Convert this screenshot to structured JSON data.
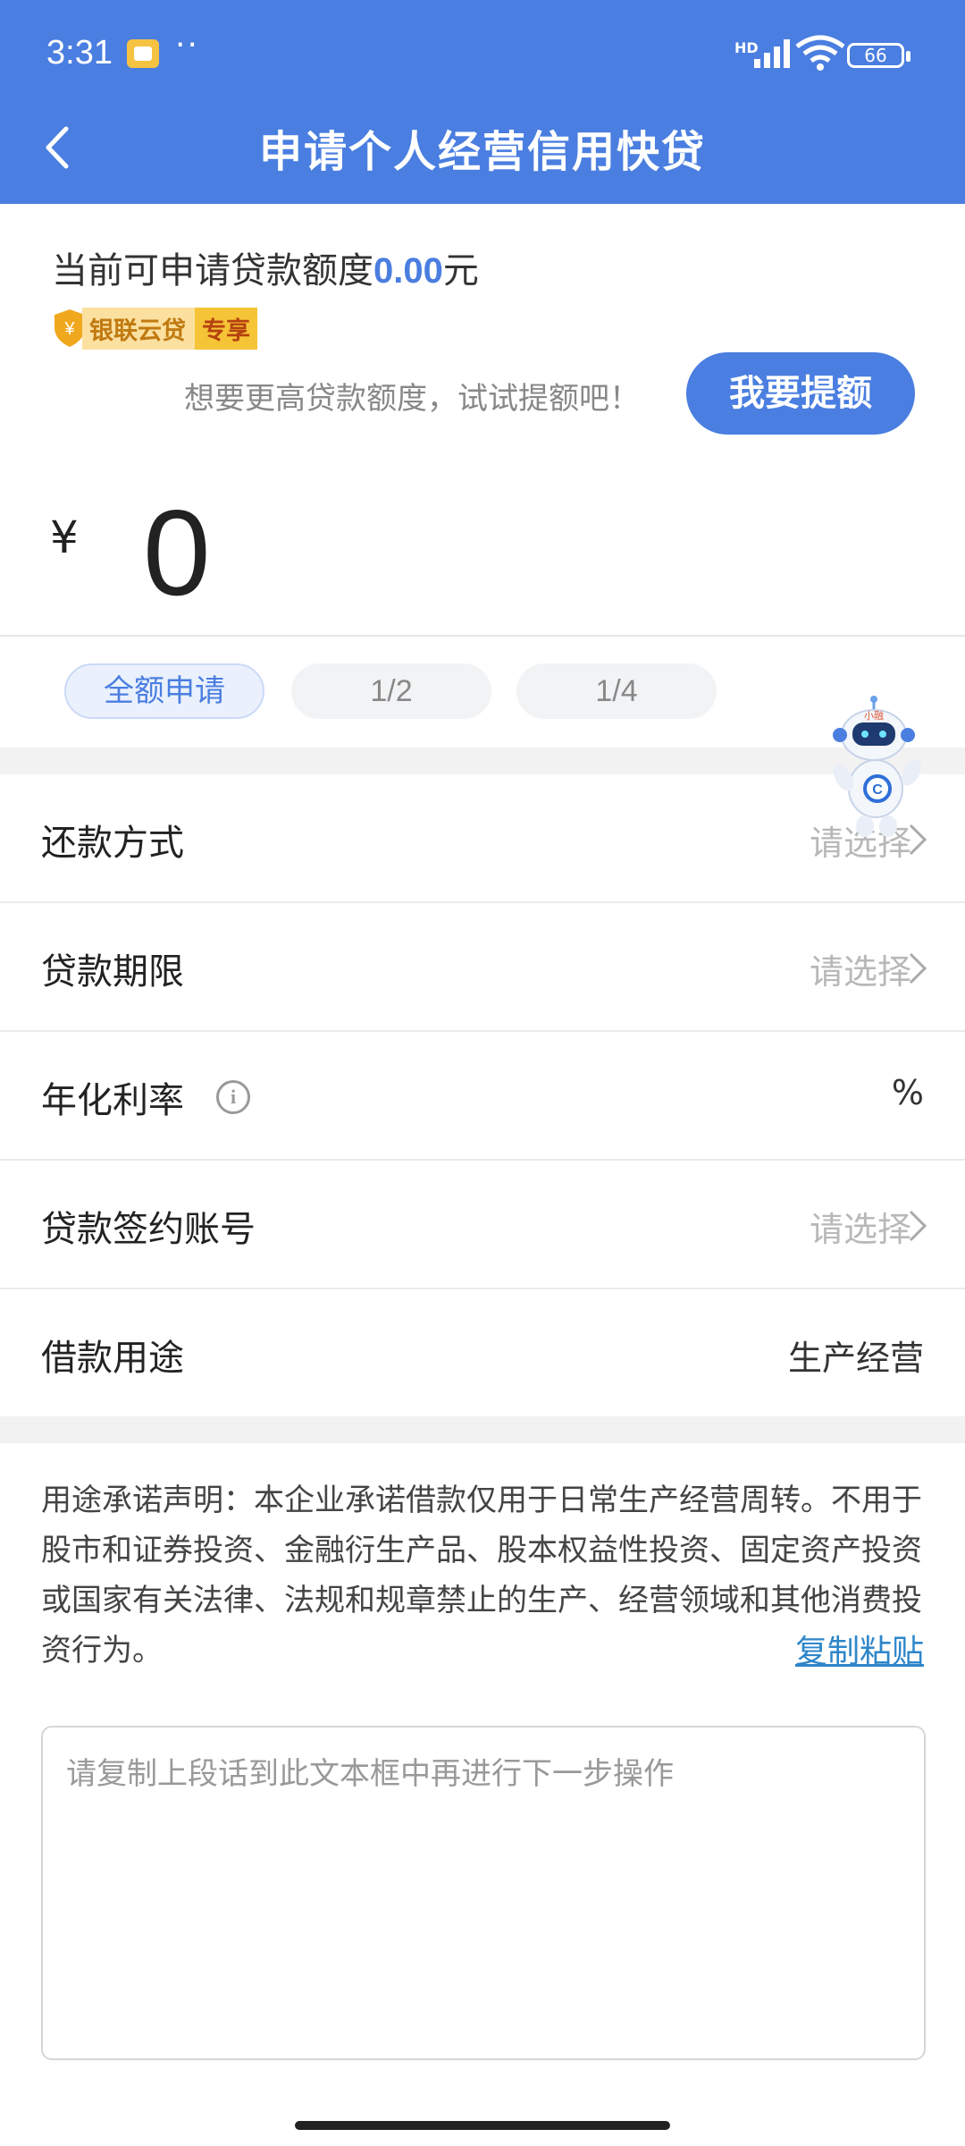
{
  "status_bar": {
    "time": "3:31",
    "network": "HD",
    "battery": "66",
    "app_icon": "notes-app-icon",
    "dots": "··"
  },
  "header": {
    "title": "申请个人经营信用快贷",
    "back_icon": "back-arrow-icon"
  },
  "quota": {
    "prefix": "当前可申请贷款额度",
    "amount": "0.00",
    "suffix": "元",
    "badge_brand": "银联云贷",
    "badge_tag": "专享",
    "raise_hint": "想要更高贷款额度，试试提额吧！",
    "raise_button": "我要提额"
  },
  "amount_input": {
    "currency": "¥",
    "value": "0"
  },
  "quick_options": [
    {
      "label": "全额申请",
      "selected": true
    },
    {
      "label": "1/2",
      "selected": false
    },
    {
      "label": "1/4",
      "selected": false
    }
  ],
  "form": {
    "repay_method": {
      "label": "还款方式",
      "value": "请选择"
    },
    "loan_term": {
      "label": "贷款期限",
      "value": "请选择"
    },
    "annual_rate": {
      "label": "年化利率",
      "value": "%"
    },
    "sign_account": {
      "label": "贷款签约账号",
      "value": "请选择"
    },
    "purpose": {
      "label": "借款用途",
      "value": "生产经营"
    }
  },
  "statement": {
    "text": "用途承诺声明：本企业承诺借款仅用于日常生产经营周转。不用于股市和证券投资、金融衍生产品、股本权益性投资、固定资产投资或国家有关法律、法规和规章禁止的生产、经营领域和其他消费投资行为。",
    "copy_link": "复制粘贴",
    "textbox_placeholder": "请复制上段话到此文本框中再进行下一步操作"
  },
  "colors": {
    "brand_blue": "#4a7ee0",
    "link_blue": "#2e86c9",
    "badge_gold": "#f6c437"
  },
  "mascot": {
    "name_tag": "小融"
  }
}
